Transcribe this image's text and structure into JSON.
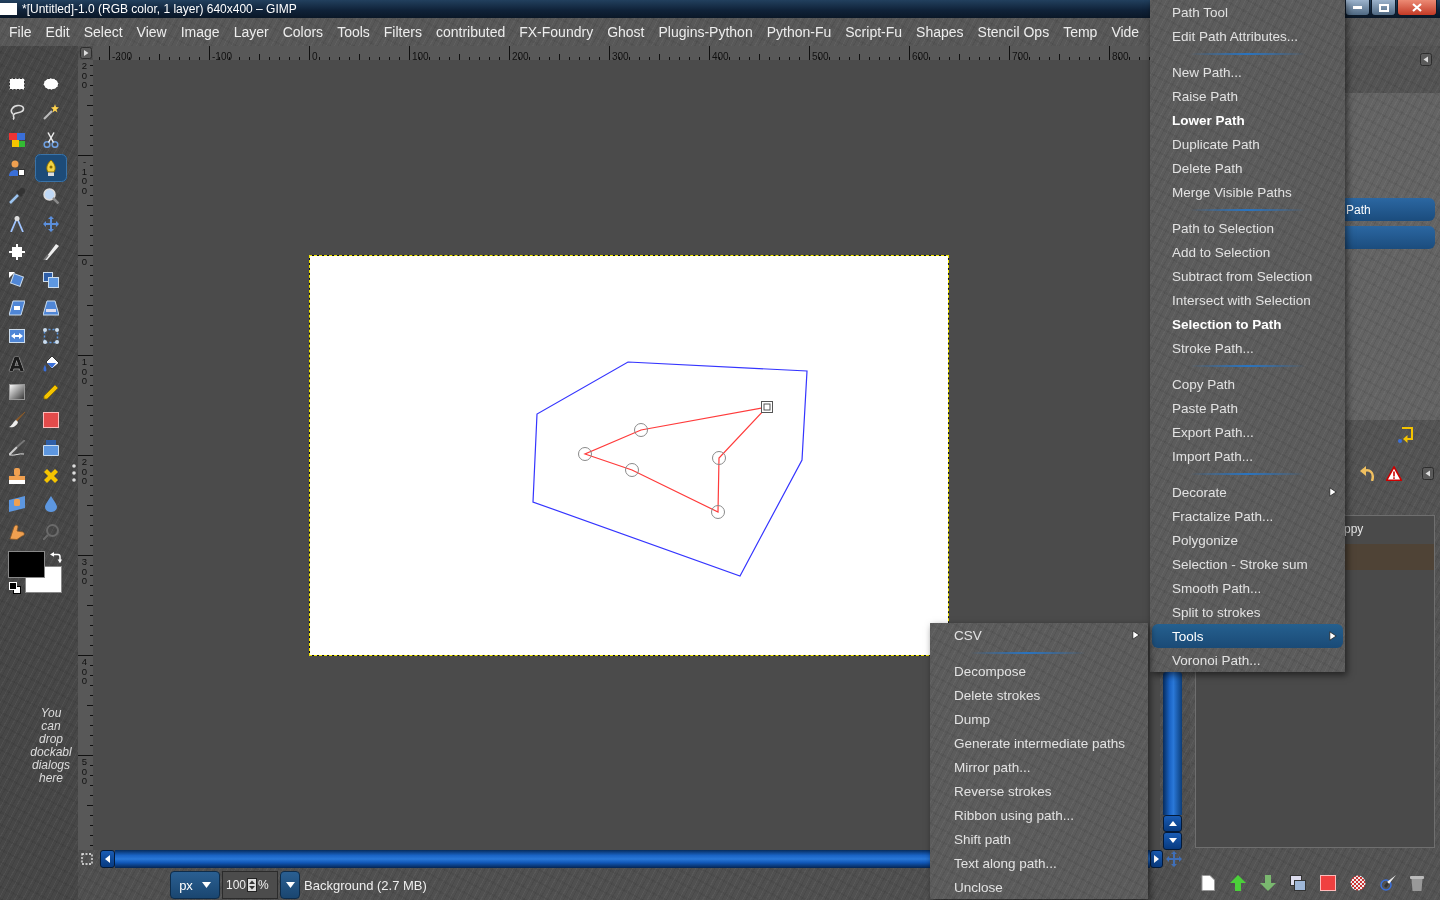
{
  "window": {
    "title": "*[Untitled]-1.0 (RGB color, 1 layer) 640x400 – GIMP"
  },
  "menu_bar": [
    "File",
    "Edit",
    "Select",
    "View",
    "Image",
    "Layer",
    "Colors",
    "Tools",
    "Filters",
    "contributed",
    "FX-Foundry",
    "Ghost",
    "Plugins-Python",
    "Python-Fu",
    "Script-Fu",
    "Shapes",
    "Stencil Ops",
    "Temp",
    "Vide"
  ],
  "toolbox": {
    "tools": [
      {
        "selected": false
      },
      {
        "selected": false
      },
      {
        "selected": false
      },
      {
        "selected": false
      },
      {
        "selected": false
      },
      {
        "selected": false
      },
      {
        "selected": false
      },
      {
        "selected": true
      },
      {
        "selected": false
      },
      {
        "selected": false
      },
      {
        "selected": false
      },
      {
        "selected": false
      },
      {
        "selected": false
      },
      {
        "selected": false
      },
      {
        "selected": false
      },
      {
        "selected": false
      },
      {
        "selected": false
      },
      {
        "selected": false
      },
      {
        "selected": false
      },
      {
        "selected": false
      },
      {
        "selected": false,
        "glyph": "A"
      },
      {
        "selected": false
      },
      {
        "selected": false
      },
      {
        "selected": false
      },
      {
        "selected": false
      },
      {
        "selected": false
      },
      {
        "selected": false
      },
      {
        "selected": false
      },
      {
        "selected": false
      },
      {
        "selected": false
      },
      {
        "selected": false
      },
      {
        "selected": false
      },
      {
        "selected": false
      },
      {
        "selected": false
      }
    ],
    "swatches": [
      {
        "kind": "foreground",
        "color": "#000000"
      },
      {
        "kind": "background",
        "color": "#ffffff"
      }
    ],
    "hint": "You can drop dockabl dialogs here"
  },
  "rulers": {
    "horizontal": [
      "-200",
      "-100",
      "0",
      "100",
      "200",
      "300",
      "400",
      "500",
      "600",
      "700",
      "800"
    ],
    "vertical": [
      "200",
      "-100",
      "0",
      "100",
      "200",
      "300",
      "400",
      "500"
    ]
  },
  "status_bar": {
    "unit": "px",
    "zoom": "100",
    "zoom_unit": "%",
    "message": "Background (2.7 MB)"
  },
  "dock": {
    "path_rows": [
      {
        "label": "Path",
        "selected": true
      },
      {
        "selected": true
      }
    ],
    "list_rows": [
      {
        "label": "ppy",
        "selected": false
      },
      {
        "selected": true
      }
    ]
  },
  "context_menu": {
    "groups": [
      {
        "items": [
          {
            "label": "Path Tool",
            "selected": false,
            "bold": false,
            "has_submenu": false
          },
          {
            "label": "Edit Path Attributes...",
            "selected": false,
            "bold": false,
            "has_submenu": false
          }
        ]
      },
      {
        "items": [
          {
            "label": "New Path...",
            "selected": false,
            "bold": false,
            "has_submenu": false
          },
          {
            "label": "Raise Path",
            "selected": false,
            "bold": false,
            "has_submenu": false
          },
          {
            "label": "Lower Path",
            "selected": false,
            "bold": true,
            "has_submenu": false
          },
          {
            "label": "Duplicate Path",
            "selected": false,
            "bold": false,
            "has_submenu": false
          },
          {
            "label": "Delete Path",
            "selected": false,
            "bold": false,
            "has_submenu": false
          },
          {
            "label": "Merge Visible Paths",
            "selected": false,
            "bold": false,
            "has_submenu": false
          }
        ]
      },
      {
        "items": [
          {
            "label": "Path to Selection",
            "selected": false,
            "bold": false,
            "has_submenu": false
          },
          {
            "label": "Add to Selection",
            "selected": false,
            "bold": false,
            "has_submenu": false
          },
          {
            "label": "Subtract from Selection",
            "selected": false,
            "bold": false,
            "has_submenu": false
          },
          {
            "label": "Intersect with Selection",
            "selected": false,
            "bold": false,
            "has_submenu": false
          },
          {
            "label": "Selection to Path",
            "selected": false,
            "bold": true,
            "has_submenu": false
          },
          {
            "label": "Stroke Path...",
            "selected": false,
            "bold": false,
            "has_submenu": false
          }
        ]
      },
      {
        "items": [
          {
            "label": "Copy Path",
            "selected": false,
            "bold": false,
            "has_submenu": false
          },
          {
            "label": "Paste Path",
            "selected": false,
            "bold": false,
            "has_submenu": false
          },
          {
            "label": "Export Path...",
            "selected": false,
            "bold": false,
            "has_submenu": false
          },
          {
            "label": "Import Path...",
            "selected": false,
            "bold": false,
            "has_submenu": false
          }
        ]
      },
      {
        "items": [
          {
            "label": "Decorate",
            "selected": false,
            "bold": false,
            "has_submenu": true
          },
          {
            "label": "Fractalize Path...",
            "selected": false,
            "bold": false,
            "has_submenu": false
          },
          {
            "label": "Polygonize",
            "selected": false,
            "bold": false,
            "has_submenu": false
          },
          {
            "label": "Selection - Stroke sum",
            "selected": false,
            "bold": false,
            "has_submenu": false
          },
          {
            "label": "Smooth Path...",
            "selected": false,
            "bold": false,
            "has_submenu": false
          },
          {
            "label": "Split to strokes",
            "selected": false,
            "bold": false,
            "has_submenu": false
          },
          {
            "label": "Tools",
            "selected": true,
            "bold": false,
            "has_submenu": true
          },
          {
            "label": "Voronoi Path...",
            "selected": false,
            "bold": false,
            "has_submenu": false
          }
        ]
      }
    ]
  },
  "tools_submenu": {
    "groups": [
      {
        "items": [
          {
            "label": "CSV",
            "selected": false,
            "has_submenu": true
          }
        ]
      },
      {
        "items": [
          {
            "label": "Decompose",
            "selected": false,
            "has_submenu": false
          },
          {
            "label": "Delete strokes",
            "selected": false,
            "has_submenu": false
          },
          {
            "label": "Dump",
            "selected": false,
            "has_submenu": false
          },
          {
            "label": "Generate intermediate paths",
            "selected": false,
            "has_submenu": false
          },
          {
            "label": "Mirror path...",
            "selected": false,
            "has_submenu": false
          },
          {
            "label": "Reverse strokes",
            "selected": false,
            "has_submenu": false
          },
          {
            "label": "Ribbon using path...",
            "selected": false,
            "has_submenu": false
          },
          {
            "label": "Shift path",
            "selected": false,
            "has_submenu": false
          },
          {
            "label": "Text along path...",
            "selected": false,
            "has_submenu": false
          },
          {
            "label": "Unclose",
            "selected": false,
            "has_submenu": false
          }
        ]
      }
    ]
  }
}
